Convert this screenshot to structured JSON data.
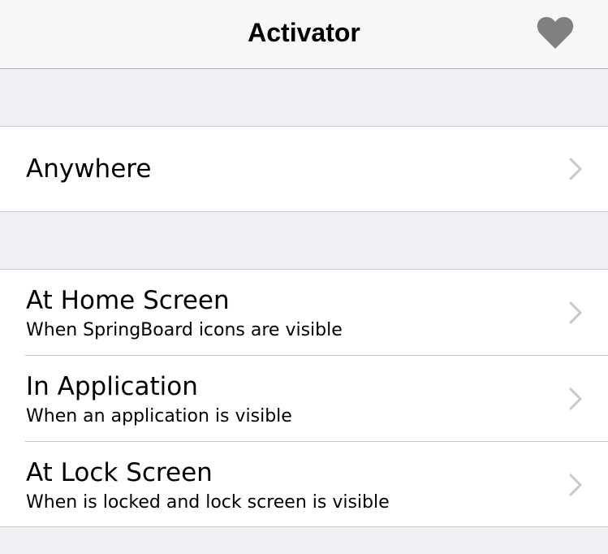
{
  "navbar": {
    "title": "Activator",
    "heart_icon": "heart-icon"
  },
  "sections": [
    {
      "cells": [
        {
          "title": "Anywhere",
          "subtitle": ""
        }
      ]
    },
    {
      "cells": [
        {
          "title": "At Home Screen",
          "subtitle": "When SpringBoard icons are visible"
        },
        {
          "title": "In Application",
          "subtitle": "When an application is visible"
        },
        {
          "title": "At Lock Screen",
          "subtitle": "When is locked and lock screen is visible"
        }
      ]
    }
  ],
  "colors": {
    "background": "#efeff4",
    "cell_background": "#ffffff",
    "chevron": "#c7c7cc",
    "heart": "#808080"
  }
}
